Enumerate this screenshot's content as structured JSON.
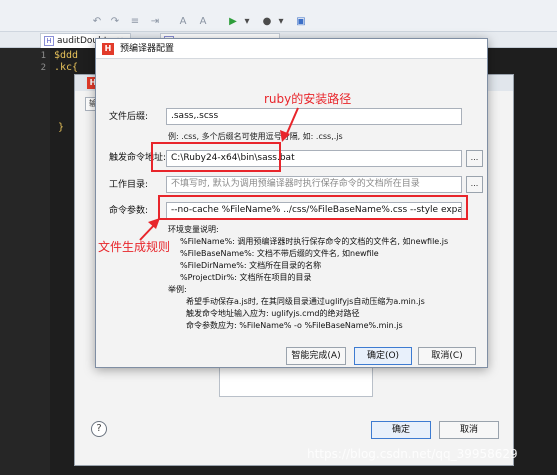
{
  "ide": {
    "tabs": [
      {
        "label": "auditDoubt",
        "icon": "html-file-icon"
      },
      {
        "label": "",
        "icon": "html-file-icon"
      }
    ],
    "code_lines": [
      {
        "no": "1",
        "text": "$ddd"
      },
      {
        "no": "2",
        "text": ".kc{"
      },
      {
        "no": "",
        "text": ""
      },
      {
        "no": "",
        "text": "}"
      }
    ]
  },
  "bg_window": {
    "select_value": "输入",
    "ok_label": "确定",
    "cancel_label": "取消",
    "help_glyph": "?"
  },
  "dialog": {
    "title": "预编译器配置",
    "logo": "H",
    "ext_label": "文件后缀:",
    "ext_value": ".sass,.scss",
    "ext_hint": "例: .css, 多个后缀名可使用逗号分隔, 如: .css,.js",
    "cmd_label": "触发命令地址:",
    "cmd_value": "C:\\Ruby24-x64\\bin\\sass.bat",
    "workdir_label": "工作目录:",
    "workdir_placeholder": "不填写时, 默认为调用预编译器时执行保存命令的文档所在目录",
    "args_label": "命令参数:",
    "args_value": "--no-cache %FileName% ../css/%FileBaseName%.css --style expanded",
    "browse_label": "...",
    "env_heading": "环境变量说明:",
    "env_lines": [
      "%FileName%: 调用预编译器时执行保存命令的文档的文件名, 如newfile.js",
      "%FileBaseName%: 文档不带后缀的文件名, 如newfile",
      "%FileDirName%: 文档所在目录的名称",
      "%ProjectDir%: 文档所在项目的目录"
    ],
    "example_heading": "举例:",
    "example_lines": [
      "希望手动保存a.js时, 在其同级目录通过uglifyjs自动压缩为a.min.js",
      "触发命令地址输入应为: uglifyjs.cmd的绝对路径",
      "命令参数应为: %FileName% -o %FileBaseName%.min.js"
    ],
    "smart_button": "智能完成(A)",
    "ok_button": "确定(O)",
    "cancel_button": "取消(C)"
  },
  "annotations": {
    "ruby_path": "ruby的安装路径",
    "output_rule": "文件生成规则",
    "color": "#e8252b"
  },
  "watermark": "https://blog.csdn.net/qq_39958629"
}
